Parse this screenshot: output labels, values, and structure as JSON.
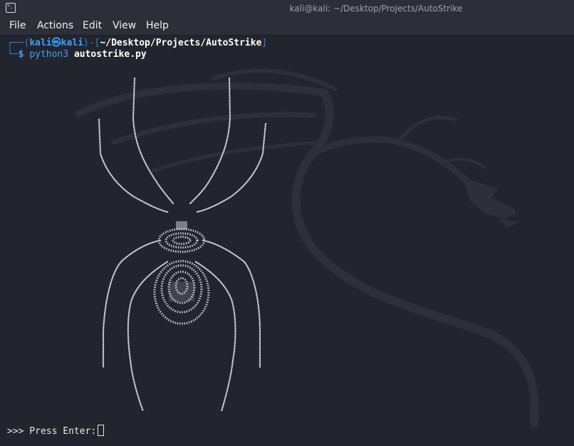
{
  "window": {
    "title": "kali@kali: ~/Desktop/Projects/AutoStrike"
  },
  "menu": {
    "items": [
      "File",
      "Actions",
      "Edit",
      "View",
      "Help"
    ]
  },
  "prompt": {
    "frame_open": "┌──(",
    "user": "kali",
    "skull": "㉿",
    "host": "kali",
    "frame_mid": ")-[",
    "cwd": "~/Desktop/Projects/AutoStrike",
    "frame_close": "]",
    "frame_bottom": "└─",
    "symbol": "$",
    "command_program": "python3",
    "command_argument": "autostrike.py"
  },
  "input_prompt": {
    "text": ">>> Press Enter:"
  },
  "icons": {
    "app": "terminal-app-icon",
    "art": "spider-ascii-art",
    "background": "kali-dragon-watermark"
  },
  "colors": {
    "background": "#23252e",
    "titlebar": "#2c2f38",
    "prompt_blue": "#2e7fd8",
    "text": "#ffffff",
    "art": "#c9ccd2"
  }
}
